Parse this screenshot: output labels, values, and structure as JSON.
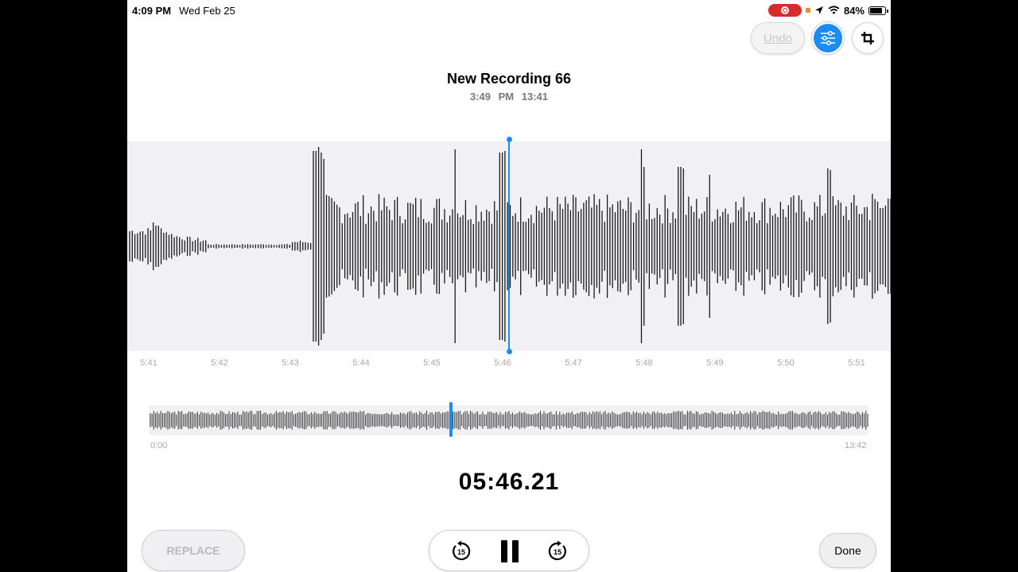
{
  "status_bar": {
    "time": "4:09 PM",
    "date": "Wed Feb 25",
    "battery": "84%",
    "battery_level": 0.84
  },
  "toolbar": {
    "undo_label": "Undo",
    "filter_icon": "sliders-icon",
    "crop_icon": "crop-icon",
    "accent_color": "#1c8cf0"
  },
  "recording": {
    "title": "New Recording 66",
    "created_time": "3:49 PM",
    "duration": "13:41"
  },
  "timeline": {
    "ticks": [
      "5:41",
      "5:42",
      "5:43",
      "5:44",
      "5:45",
      "5:46",
      "5:47",
      "5:48",
      "5:49",
      "5:50",
      "5:51"
    ]
  },
  "overview": {
    "start_label": "0:00",
    "end_label": "13:42",
    "playhead_position": 0.42
  },
  "playback": {
    "current_time": "05:46.21"
  },
  "controls": {
    "replace_label": "REPLACE",
    "skip_back_value": "15",
    "skip_forward_value": "15",
    "done_label": "Done"
  }
}
